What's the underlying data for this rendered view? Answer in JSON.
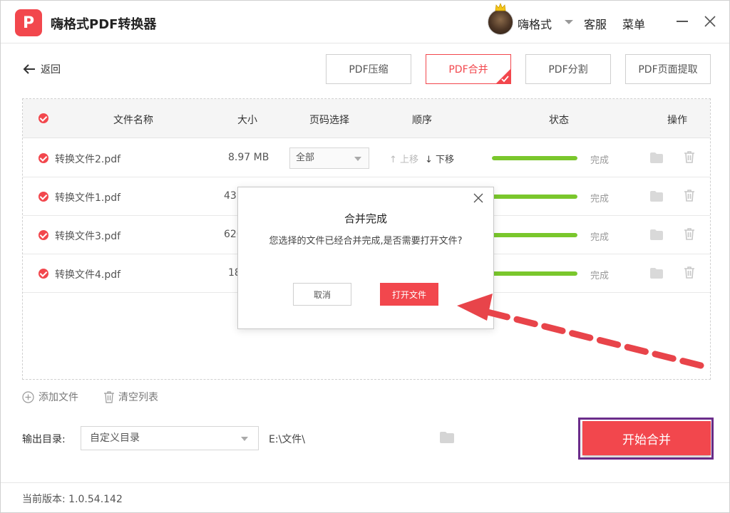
{
  "app": {
    "logo_letter": "P",
    "title": "嗨格式PDF转换器",
    "username": "嗨格式",
    "service_label": "客服",
    "menu_label": "菜单"
  },
  "nav": {
    "back_label": "返回",
    "tabs": [
      {
        "label": "PDF压缩",
        "active": false
      },
      {
        "label": "PDF合并",
        "active": true
      },
      {
        "label": "PDF分割",
        "active": false
      },
      {
        "label": "PDF页面提取",
        "active": false
      }
    ]
  },
  "table": {
    "headers": {
      "name": "文件名称",
      "size": "大小",
      "pages": "页码选择",
      "order": "顺序",
      "status": "状态",
      "actions": "操作"
    },
    "rows": [
      {
        "name": "转换文件2.pdf",
        "size": "8.97 MB",
        "pages": "全部",
        "up": "上移",
        "down": "下移",
        "progress": 1.0,
        "status": "完成"
      },
      {
        "name": "转换文件1.pdf",
        "size": "437",
        "pages": "",
        "up": "",
        "down": "",
        "progress": 1.0,
        "status": "完成"
      },
      {
        "name": "转换文件3.pdf",
        "size": "620",
        "pages": "",
        "up": "",
        "down": "",
        "progress": 1.0,
        "status": "完成"
      },
      {
        "name": "转换文件4.pdf",
        "size": "18",
        "pages": "",
        "up": "",
        "down": "",
        "progress": 1.0,
        "status": "完成"
      }
    ]
  },
  "toolbar": {
    "add_file_label": "添加文件",
    "clear_list_label": "清空列表"
  },
  "output": {
    "label": "输出目录:",
    "selected": "自定义目录",
    "path": "E:\\文件\\"
  },
  "start_label": "开始合并",
  "footer": {
    "version_label": "当前版本: 1.0.54.142"
  },
  "dialog": {
    "title": "合并完成",
    "message": "您选择的文件已经合并完成,是否需要打开文件?",
    "cancel_label": "取消",
    "open_label": "打开文件"
  },
  "colors": {
    "accent": "#f2474d",
    "progress": "#7ac72c",
    "highlight_outline": "#6b2d8b"
  }
}
